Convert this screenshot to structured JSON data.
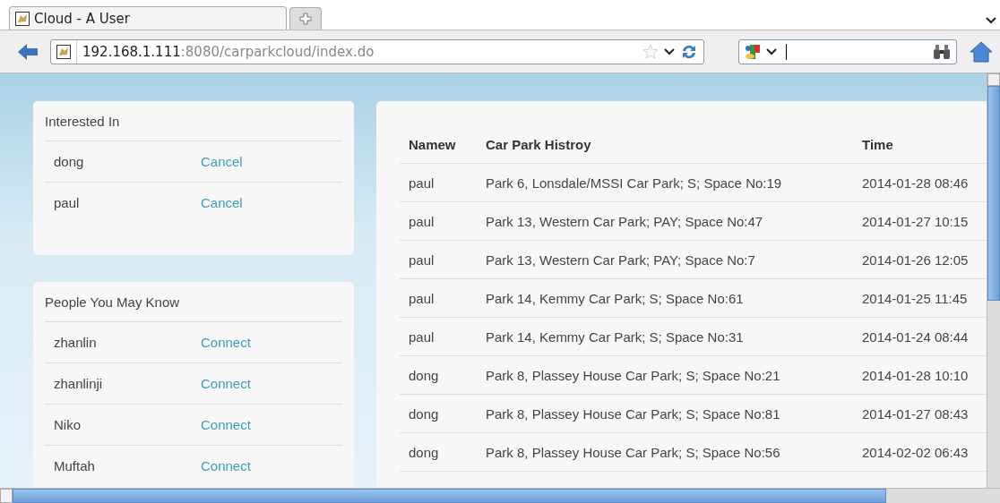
{
  "browser": {
    "tabs": [
      {
        "label": "Cloud - A User",
        "selected": true
      }
    ],
    "address": {
      "host": "192.168.1.111",
      "rest": ":8080/carparkcloud/index.do"
    }
  },
  "interested": {
    "title": "Interested In",
    "items": [
      {
        "name": "dong",
        "action": "Cancel"
      },
      {
        "name": "paul",
        "action": "Cancel"
      }
    ]
  },
  "people": {
    "title": "People You May Know",
    "items": [
      {
        "name": "zhanlin",
        "action": "Connect"
      },
      {
        "name": "zhanlinji",
        "action": "Connect"
      },
      {
        "name": "Niko",
        "action": "Connect"
      },
      {
        "name": "Muftah",
        "action": "Connect"
      }
    ]
  },
  "table": {
    "columns": [
      "Namew",
      "Car Park Histroy",
      "Time"
    ],
    "rows": [
      [
        "paul",
        "Park 6, Lonsdale/MSSI Car Park; S; Space No:19",
        "2014-01-28 08:46"
      ],
      [
        "paul",
        "Park 13, Western Car Park; PAY; Space No:47",
        "2014-01-27 10:15"
      ],
      [
        "paul",
        "Park 13, Western Car Park; PAY; Space No:7",
        "2014-01-26 12:05"
      ],
      [
        "paul",
        "Park 14, Kemmy Car Park; S; Space No:61",
        "2014-01-25 11:45"
      ],
      [
        "paul",
        "Park 14, Kemmy Car Park; S; Space No:31",
        "2014-01-24 08:44"
      ],
      [
        "dong",
        "Park 8, Plassey House Car Park; S; Space No:21",
        "2014-01-28 10:10"
      ],
      [
        "dong",
        "Park 8, Plassey House Car Park; S; Space No:81",
        "2014-01-27 08:43"
      ],
      [
        "dong",
        "Park 8, Plassey House Car Park; S; Space No:56",
        "2014-02-02 06:43"
      ]
    ]
  }
}
